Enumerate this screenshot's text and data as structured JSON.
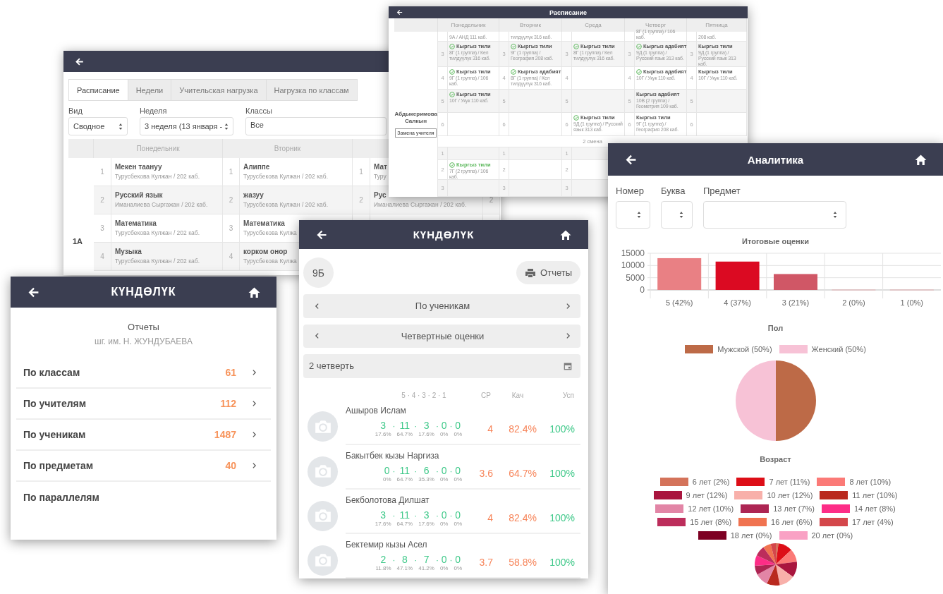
{
  "schedule_window": {
    "tabs": [
      {
        "label": "Расписание",
        "selected": true
      },
      {
        "label": "Недели",
        "selected": false
      },
      {
        "label": "Учительская нагрузка",
        "selected": false
      },
      {
        "label": "Нагрузка по классам",
        "selected": false
      }
    ],
    "filters": [
      {
        "label": "Вид",
        "value": "Сводное",
        "kind": "select"
      },
      {
        "label": "Неделя",
        "value": "3 неделя (13 января -",
        "kind": "select"
      },
      {
        "label": "Классы",
        "value": "Все",
        "kind": "text"
      }
    ],
    "days": [
      "Понедельник",
      "Вторник"
    ],
    "class_name": "1А",
    "rows": [
      {
        "lessons": [
          {
            "number": "1",
            "subject": "Мекен таануу",
            "detail": "Турусбекова Кулжан / 202 каб."
          },
          {
            "number": "1",
            "subject": "Алиппе",
            "detail": "Турусбекова Кулжан / 202 каб."
          },
          {
            "number": "1",
            "subject": "Мат",
            "detail": "Туру"
          }
        ]
      },
      {
        "lessons": [
          {
            "number": "2",
            "subject": "Русский язык",
            "detail": "Иманалиева Сыргажан / 202 каб."
          },
          {
            "number": "2",
            "subject": "жазуу",
            "detail": "Турусбекова Кулжан / 202 каб."
          },
          {
            "number": "2",
            "subject": "Рус",
            "detail": "Иманалиева Сыргажан / 202 каб."
          },
          {
            "number": "2"
          }
        ]
      },
      {
        "lessons": [
          {
            "number": "3",
            "subject": "Математика",
            "detail": "Турусбекова Кулжан / 202 каб."
          },
          {
            "number": "3",
            "subject": "Математика",
            "detail": "Турусбекова Кулжа"
          }
        ]
      },
      {
        "lessons": [
          {
            "number": "4",
            "subject": "Музыка",
            "detail": "Турусбекова Кулжан / 202 каб."
          },
          {
            "number": "4",
            "subject": "корком онор",
            "detail": "Турусбекова Кулжа"
          }
        ]
      }
    ]
  },
  "teacher_schedule": {
    "title": "Расписание",
    "days": [
      "Понедельник",
      "Вторник",
      "Среда",
      "Четверг",
      "Пятница"
    ],
    "teacher": "Абдыкеримова Салкын",
    "replace_button": "Замена учителя",
    "first_shift": [
      {
        "cells": [
          {
            "detail": "9А / АНД 111 каб."
          },
          {
            "detail": "тилдүүлүк 316 каб."
          },
          {},
          {
            "detail": "8Г (1 группа) / 106 каб."
          },
          {
            "detail": "208 каб."
          }
        ]
      },
      {
        "cells": [
          {
            "number": "3",
            "title": "Кыргыз тили",
            "detail": "8Г (1 группа) / Кел тилдүүлүк 316 каб.",
            "confirmed": true,
            "current": false
          },
          {
            "number": "3",
            "title": "Кыргыз тили",
            "detail": "9Г (1 группа) / География 208 каб.",
            "confirmed": true,
            "current": false
          },
          {
            "number": "3",
            "title": "Кыргыз тили",
            "detail": "8Г (1 группа) / Кел тилдүүлүк 316 каб.",
            "confirmed": true,
            "current": false
          },
          {
            "number": "3",
            "title": "Кыргыз адабият",
            "detail": "9Д (1 группа) / Русский язык 313 каб.",
            "confirmed": true,
            "current": false
          },
          {
            "number": "3",
            "title": "Кыргыз тили",
            "detail": "9Д (1 группа) / Русский язык 313 каб.",
            "confirmed": false,
            "current": false
          }
        ]
      },
      {
        "cells": [
          {
            "number": "4",
            "title": "Кыргыз тили",
            "detail": "9Г (1 группа) / 106 каб.",
            "confirmed": true,
            "current": false
          },
          {
            "number": "4",
            "title": "Кыргыз адабият",
            "detail": "8Г (1 группа) / Кел тилдүүлүк 316 каб.",
            "confirmed": true,
            "current": false
          },
          {
            "number": "4"
          },
          {
            "number": "4",
            "title": "Кыргыз адабият",
            "detail": "10Г / Укук 110 каб.",
            "confirmed": true,
            "current": false
          },
          {
            "number": "4",
            "title": "Кыргыз тили",
            "detail": "10Г / Укук 110 каб.",
            "confirmed": false,
            "current": false
          }
        ]
      },
      {
        "cells": [
          {
            "number": "5",
            "title": "Кыргыз тили",
            "detail": "10Г / Укук 110 каб.",
            "confirmed": true,
            "current": false
          },
          {
            "number": "5"
          },
          {
            "number": "5"
          },
          {
            "number": "5",
            "title": "Кыргыз адабият",
            "detail": "10В (2 группа) / Геометрия 109 каб.",
            "confirmed": false,
            "current": false
          },
          {
            "number": "5"
          }
        ]
      },
      {
        "cells": [
          {
            "number": "6"
          },
          {
            "number": "6"
          },
          {
            "number": "6",
            "title": "Кыргыз тили",
            "detail": "9Д (1 группа) / Русский язык 313 каб.",
            "confirmed": true,
            "current": false
          },
          {
            "number": "6",
            "title": "Кыргыз тили",
            "detail": "9Г (1 группа) / География 208 каб.",
            "confirmed": false,
            "current": false
          },
          {
            "number": "6"
          }
        ]
      }
    ],
    "shift_label": "2 смена",
    "second_shift": [
      {
        "cells": [
          {
            "number": "1"
          },
          {
            "number": "1"
          },
          {
            "number": "1"
          }
        ]
      },
      {
        "cells": [
          {
            "number": "2",
            "title": "Кыргыз тили",
            "detail": "7Г (2 группа) / 106 каб.",
            "confirmed": true,
            "current": true
          },
          {
            "number": "2"
          },
          {
            "number": "2"
          }
        ]
      },
      {
        "cells": [
          {
            "number": "3"
          },
          {
            "number": "3"
          },
          {
            "number": "3"
          }
        ]
      }
    ]
  },
  "reports_menu": {
    "logo": "КҮНДӨЛҮК",
    "title": "Отчеты",
    "school": "шг. им. Н. ЖУНДУБАЕВА",
    "items": [
      {
        "label": "По классам",
        "count": "61",
        "arrow": true
      },
      {
        "label": "По учителям",
        "count": "112",
        "arrow": true
      },
      {
        "label": "По ученикам",
        "count": "1487",
        "arrow": true
      },
      {
        "label": "По предметам",
        "count": "40",
        "arrow": true
      },
      {
        "label": "По параллелям",
        "arrow": false
      }
    ]
  },
  "class_report": {
    "logo": "КҮНДӨЛҮК",
    "class_badge": "9Б",
    "reports_button": "Отчеты",
    "selectors": [
      {
        "label": "По ученикам"
      },
      {
        "label": "Четвертные оценки"
      }
    ],
    "period_field": {
      "value": "2 четверть"
    },
    "columns": {
      "grades": "5 · 4 · 3 · 2 · 1",
      "average": "СР",
      "quality": "Кач",
      "success": "Усп"
    },
    "separator": "·",
    "students": [
      {
        "name": "Ашыров Ислам",
        "grades": [
          {
            "count": "3",
            "share": "17.6%"
          },
          {
            "count": "11",
            "share": "64.7%"
          },
          {
            "count": "3",
            "share": "17.6%"
          },
          {
            "count": "0",
            "share": "0%"
          },
          {
            "count": "0",
            "share": "0%"
          }
        ],
        "average": "4",
        "quality": "82.4%",
        "success": "100%"
      },
      {
        "name": "Бакытбек кызы Наргиза",
        "grades": [
          {
            "count": "0",
            "share": "0%"
          },
          {
            "count": "11",
            "share": "64.7%"
          },
          {
            "count": "6",
            "share": "35.3%"
          },
          {
            "count": "0",
            "share": "0%"
          },
          {
            "count": "0",
            "share": "0%"
          }
        ],
        "average": "3.6",
        "quality": "64.7%",
        "success": "100%"
      },
      {
        "name": "Бекболотова Дилшат",
        "grades": [
          {
            "count": "3",
            "share": "17.6%"
          },
          {
            "count": "11",
            "share": "64.7%"
          },
          {
            "count": "3",
            "share": "17.6%"
          },
          {
            "count": "0",
            "share": "0%"
          },
          {
            "count": "0",
            "share": "0%"
          }
        ],
        "average": "4",
        "quality": "82.4%",
        "success": "100%"
      },
      {
        "name": "Бектемир кызы Асел",
        "grades": [
          {
            "count": "2",
            "share": "11.8%"
          },
          {
            "count": "8",
            "share": "47.1%"
          },
          {
            "count": "7",
            "share": "41.2%"
          },
          {
            "count": "0",
            "share": "0%"
          },
          {
            "count": "0",
            "share": "0%"
          }
        ],
        "average": "3.7",
        "quality": "58.8%",
        "success": "100%"
      }
    ]
  },
  "analytics": {
    "title": "Аналитика",
    "filters": [
      {
        "label": "Номер"
      },
      {
        "label": "Буква"
      },
      {
        "label": "Предмет"
      }
    ],
    "grades_chart": {
      "chart_data": {
        "type": "bar",
        "title": "Итоговые оценки",
        "categories": [
          "5 (42%)",
          "4 (37%)",
          "3 (21%)",
          "2 (0%)",
          "1 (0%)"
        ],
        "values": [
          13000,
          11600,
          6500,
          0,
          0
        ],
        "colors": [
          "#e98084",
          "#db0a22",
          "#d05766",
          "#e98084",
          "#e98084"
        ],
        "ylim": [
          0,
          15000
        ],
        "yticks": [
          0,
          5000,
          10000,
          15000
        ]
      }
    },
    "gender_chart": {
      "chart_data": {
        "type": "pie",
        "title": "Пол",
        "categories": [
          "Мужской (50%)",
          "Женский (50%)"
        ],
        "values": [
          50,
          50
        ],
        "colors": [
          "#bd6a47",
          "#f7c2d6"
        ]
      }
    },
    "age_chart": {
      "chart_data": {
        "type": "pie",
        "title": "Возраст",
        "categories": [
          "6 лет (2%)",
          "7 лет (11%)",
          "8 лет (10%)",
          "9 лет (12%)",
          "10 лет (12%)",
          "11 лет (10%)",
          "12 лет (10%)",
          "13 лет (7%)",
          "14 лет (8%)",
          "15 лет (8%)",
          "16 лет (6%)",
          "17 лет (4%)",
          "18 лет (0%)",
          "20 лет (0%)"
        ],
        "values": [
          2,
          11,
          10,
          12,
          12,
          10,
          10,
          7,
          8,
          8,
          6,
          4,
          0,
          0
        ],
        "colors": [
          "#d4735a",
          "#dd0e17",
          "#fb7a77",
          "#a9153e",
          "#f8b0aa",
          "#b9291e",
          "#e285a6",
          "#ad2553",
          "#fd2d87",
          "#bc2d5b",
          "#f07350",
          "#d4474b",
          "#7d0023",
          "#f9a1c4"
        ]
      }
    }
  }
}
